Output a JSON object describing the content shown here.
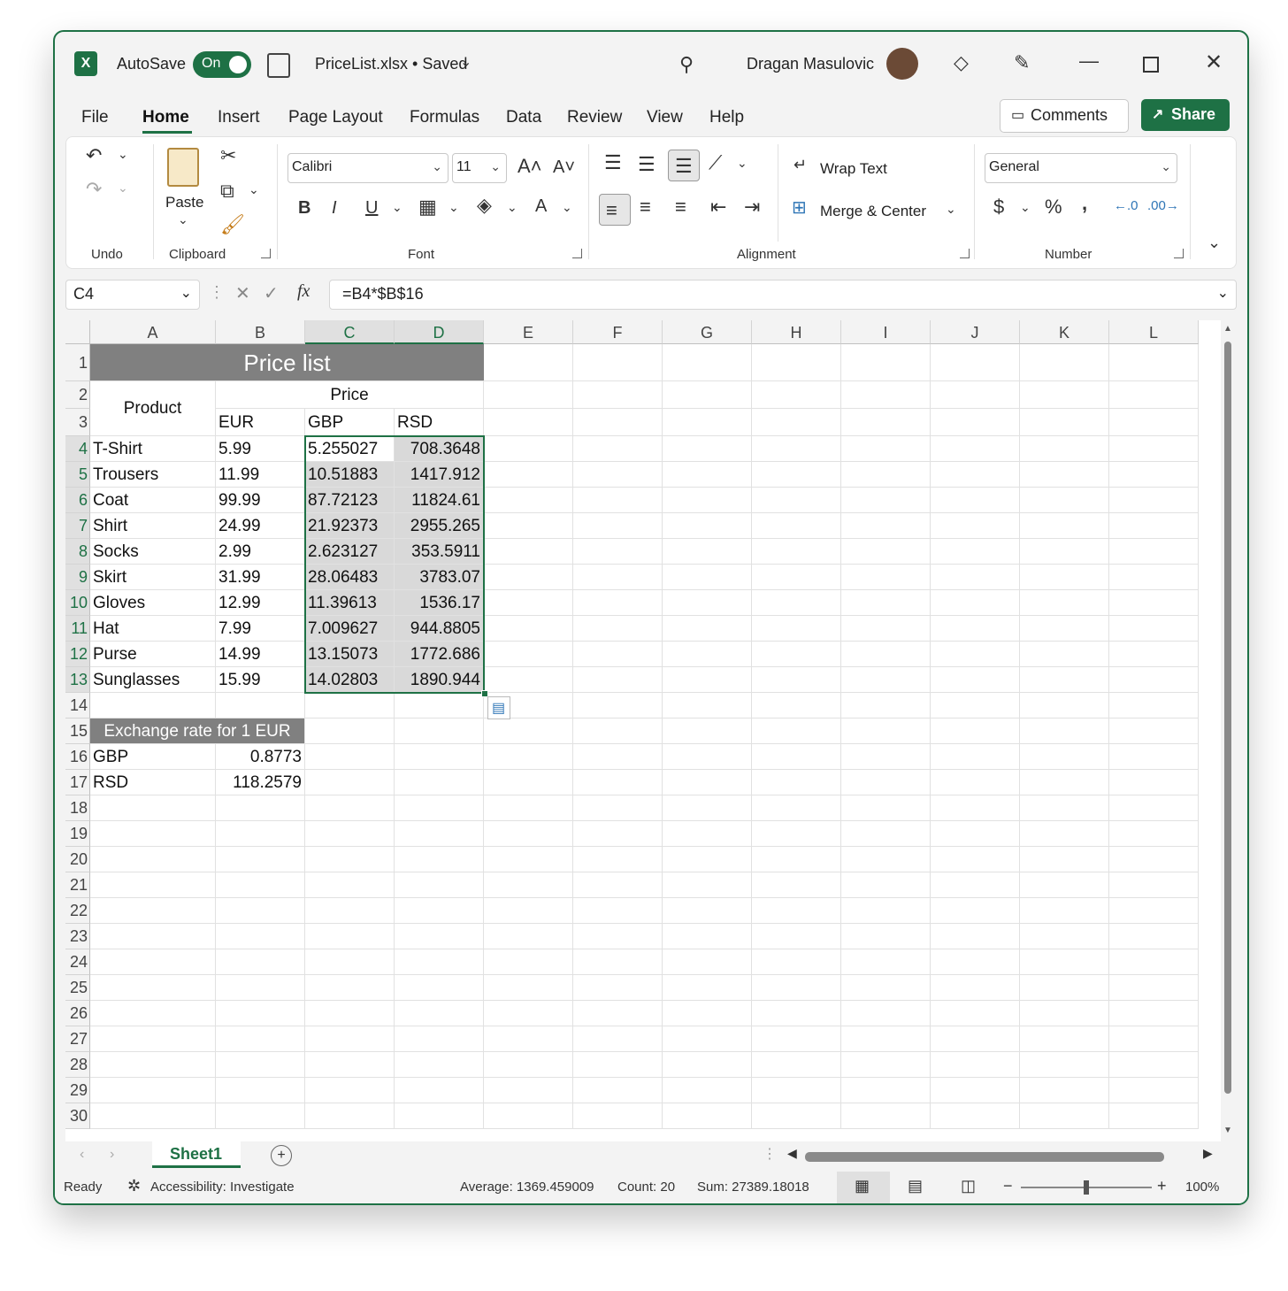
{
  "titlebar": {
    "autosave_label": "AutoSave",
    "toggle_state": "On",
    "filename": "PriceList.xlsx • Saved",
    "user_name": "Dragan Masulovic"
  },
  "menu": {
    "items": [
      "File",
      "Home",
      "Insert",
      "Page Layout",
      "Formulas",
      "Data",
      "Review",
      "View",
      "Help"
    ],
    "active": "Home",
    "comments_label": "Comments",
    "share_label": "Share"
  },
  "ribbon": {
    "groups": {
      "undo": "Undo",
      "clipboard": "Clipboard",
      "font": "Font",
      "alignment": "Alignment",
      "number": "Number"
    },
    "paste_label": "Paste",
    "font_name": "Calibri",
    "font_size": "11",
    "wrap_text": "Wrap Text",
    "merge_center": "Merge & Center",
    "number_format": "General"
  },
  "formula_bar": {
    "name_box": "C4",
    "formula": "=B4*$B$16"
  },
  "grid": {
    "columns": [
      "A",
      "B",
      "C",
      "D",
      "E",
      "F",
      "G",
      "H",
      "I",
      "J",
      "K",
      "L"
    ],
    "selected_columns": [
      "C",
      "D"
    ],
    "rows": [
      "1",
      "2",
      "3",
      "4",
      "5",
      "6",
      "7",
      "8",
      "9",
      "10",
      "11",
      "12",
      "13",
      "14",
      "15",
      "16",
      "17",
      "18",
      "19",
      "20",
      "21",
      "22",
      "23",
      "24",
      "25",
      "26",
      "27",
      "28",
      "29",
      "30"
    ],
    "selected_rows": [
      "4",
      "5",
      "6",
      "7",
      "8",
      "9",
      "10",
      "11",
      "12",
      "13"
    ],
    "title": "Price list",
    "product_header": "Product",
    "price_header": "Price",
    "currency_headers": [
      "EUR",
      "GBP",
      "RSD"
    ],
    "products": [
      {
        "name": "T-Shirt",
        "eur": "5.99",
        "gbp": "5.255027",
        "rsd": "708.3648"
      },
      {
        "name": "Trousers",
        "eur": "11.99",
        "gbp": "10.51883",
        "rsd": "1417.912"
      },
      {
        "name": "Coat",
        "eur": "99.99",
        "gbp": "87.72123",
        "rsd": "11824.61"
      },
      {
        "name": "Shirt",
        "eur": "24.99",
        "gbp": "21.92373",
        "rsd": "2955.265"
      },
      {
        "name": "Socks",
        "eur": "2.99",
        "gbp": "2.623127",
        "rsd": "353.5911"
      },
      {
        "name": "Skirt",
        "eur": "31.99",
        "gbp": "28.06483",
        "rsd": "3783.07"
      },
      {
        "name": "Gloves",
        "eur": "12.99",
        "gbp": "11.39613",
        "rsd": "1536.17"
      },
      {
        "name": "Hat",
        "eur": "7.99",
        "gbp": "7.009627",
        "rsd": "944.8805"
      },
      {
        "name": "Purse",
        "eur": "14.99",
        "gbp": "13.15073",
        "rsd": "1772.686"
      },
      {
        "name": "Sunglasses",
        "eur": "15.99",
        "gbp": "14.02803",
        "rsd": "1890.944"
      }
    ],
    "exchange_title": "Exchange rate for 1 EUR",
    "rates": [
      {
        "code": "GBP",
        "value": "0.8773"
      },
      {
        "code": "RSD",
        "value": "118.2579"
      }
    ]
  },
  "sheets": {
    "active": "Sheet1"
  },
  "status": {
    "ready": "Ready",
    "accessibility": "Accessibility: Investigate",
    "average": "Average: 1369.459009",
    "count": "Count: 20",
    "sum": "Sum: 27389.18018",
    "zoom": "100%"
  },
  "colors": {
    "accent": "#1e7145",
    "band": "#808080",
    "selection": "#d9d9d9"
  }
}
